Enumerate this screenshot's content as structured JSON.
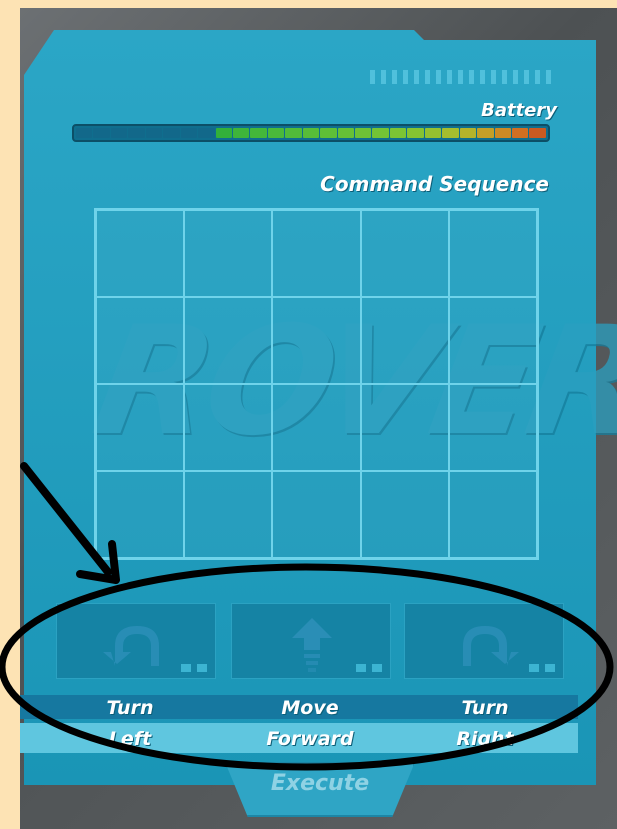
{
  "battery": {
    "label": "Battery",
    "cells": [
      "#12688a",
      "#12688a",
      "#12688a",
      "#12688a",
      "#12688a",
      "#12688a",
      "#12688a",
      "#12688a",
      "#33b03a",
      "#3fb43a",
      "#44b73a",
      "#4ab93a",
      "#51bb39",
      "#58bd38",
      "#5fbf37",
      "#66c136",
      "#6dc235",
      "#74c335",
      "#7bc434",
      "#86c332",
      "#95c130",
      "#a5bd2e",
      "#b4b32b",
      "#c39f28",
      "#cc8a25",
      "#d06f22",
      "#c95a22"
    ]
  },
  "sequence": {
    "label": "Command Sequence",
    "watermark": "ROVER",
    "grid_cols": 5,
    "grid_rows": 4
  },
  "commands": [
    {
      "line1": "Turn",
      "line2": "Left",
      "icon": "turn-left-arrow-icon"
    },
    {
      "line1": "Move",
      "line2": "Forward",
      "icon": "move-forward-arrow-icon"
    },
    {
      "line1": "Turn",
      "line2": "Right",
      "icon": "turn-right-arrow-icon"
    }
  ],
  "execute": {
    "label": "Execute"
  },
  "colors": {
    "panel": "#1f9bbd",
    "annotation": "#000000"
  }
}
